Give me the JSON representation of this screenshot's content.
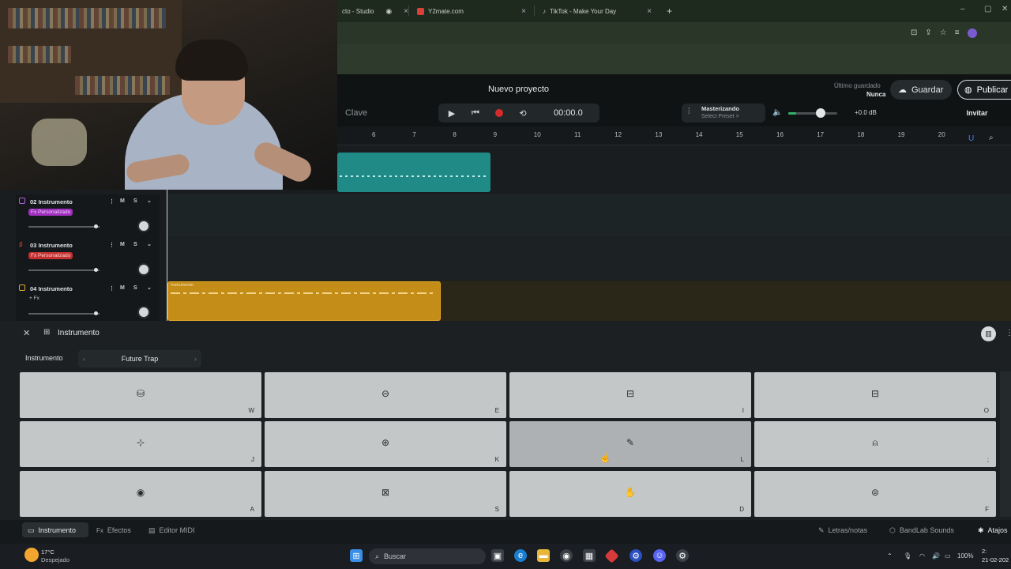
{
  "browser": {
    "tabs": [
      {
        "title": "cto - Studio",
        "icon": "studio-icon"
      },
      {
        "title": "Y2mate.com",
        "icon": "y2mate-icon"
      },
      {
        "title": "TikTok - Make Your Day",
        "icon": "tiktok-icon"
      }
    ],
    "new_tab": "+",
    "controls": {
      "minimize": "–",
      "maximize": "▢",
      "close": "✕"
    }
  },
  "header": {
    "project_title": "Nuevo proyecto",
    "key_label": "Clave",
    "time": "00:00.0",
    "mastering_title": "Masterizando",
    "mastering_sub": "Select Preset >",
    "volume_db": "+0.0 dB",
    "volume_level_fraction": 0.65,
    "saved_label": "Último guardado",
    "saved_value": "Nunca",
    "save_button": "Guardar",
    "publish_button": "Publicar",
    "invite_button": "Invitar"
  },
  "ruler": {
    "ticks": [
      "6",
      "7",
      "8",
      "9",
      "10",
      "11",
      "12",
      "13",
      "14",
      "15",
      "16",
      "17",
      "18",
      "19",
      "20"
    ]
  },
  "tracks": [
    {
      "number": "02",
      "name": "Instrumento",
      "fx": "Fx Personalizado",
      "fx_color": "#a12fbf",
      "mute": "M",
      "solo": "S"
    },
    {
      "number": "03",
      "name": "Instrumento",
      "fx": "Fx Personalizado",
      "fx_color": "#c43030",
      "mute": "M",
      "solo": "S"
    },
    {
      "number": "04",
      "name": "Instrumento",
      "fx": "+ Fx",
      "fx_color": "",
      "mute": "M",
      "solo": "S"
    }
  ],
  "clips": {
    "gold_label": "Instrumento"
  },
  "instrument_panel": {
    "title": "Instrumento",
    "label": "Instrumento",
    "kit": "Future Trap",
    "pads": [
      {
        "icon": "kick-drum-icon",
        "glyph": "⛁",
        "key": "W"
      },
      {
        "icon": "snare-icon",
        "glyph": "⊖",
        "key": "E"
      },
      {
        "icon": "tom-icon",
        "glyph": "⊟",
        "key": "I"
      },
      {
        "icon": "floor-tom-icon",
        "glyph": "⊟",
        "key": "O"
      },
      {
        "icon": "cymbal-icon",
        "glyph": "⊹",
        "key": "J"
      },
      {
        "icon": "hihat-icon",
        "glyph": "⊕",
        "key": "K"
      },
      {
        "icon": "drumstick-icon",
        "glyph": "✎",
        "key": "L"
      },
      {
        "icon": "bell-icon",
        "glyph": "⍝",
        "key": ";"
      },
      {
        "icon": "clap-icon",
        "glyph": "◉",
        "key": "A"
      },
      {
        "icon": "drum-icon",
        "glyph": "⊠",
        "key": "S"
      },
      {
        "icon": "hand-icon",
        "glyph": "✋",
        "key": "D"
      },
      {
        "icon": "conga-icon",
        "glyph": "⊜",
        "key": "F"
      }
    ]
  },
  "bottom_tabs": {
    "instrument": "Instrumento",
    "effects": "Efectos",
    "midi": "Editor MIDI",
    "lyrics": "Letras/notas",
    "sounds": "BandLab Sounds",
    "shortcuts": "Atajos",
    "fx_prefix": "Fx"
  },
  "taskbar": {
    "temperature": "17°C",
    "weather": "Despejado",
    "search": "Buscar",
    "battery": "100%",
    "time": "2:",
    "date": "21-02-202"
  }
}
